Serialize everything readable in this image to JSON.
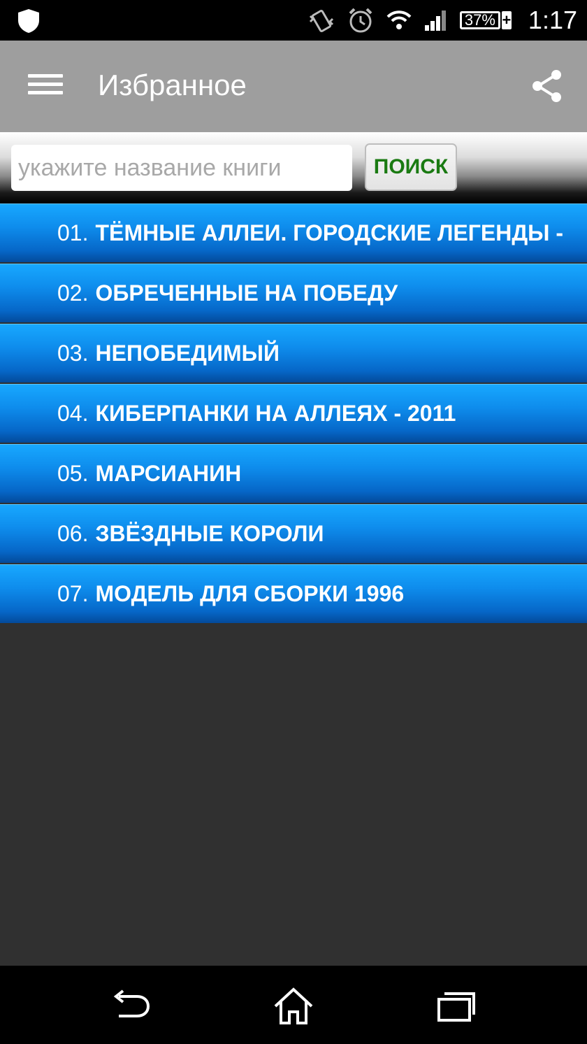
{
  "status_bar": {
    "battery_percent": "37%",
    "time": "1:17",
    "icons": [
      "shield-icon",
      "vibrate-icon",
      "alarm-icon",
      "wifi-icon",
      "signal-icon",
      "battery-icon"
    ]
  },
  "app_bar": {
    "title": "Избранное",
    "menu_icon": "hamburger-menu-icon",
    "share_icon": "share-icon"
  },
  "search": {
    "placeholder": "укажите название книги",
    "value": "",
    "button_label": "ПОИСК"
  },
  "books": [
    {
      "num": "01.",
      "title": "ТЁМНЫЕ АЛЛЕИ. ГОРОДСКИЕ ЛЕГЕНДЫ -"
    },
    {
      "num": "02.",
      "title": "ОБРЕЧЕННЫЕ НА ПОБЕДУ"
    },
    {
      "num": "03.",
      "title": "НЕПОБЕДИМЫЙ"
    },
    {
      "num": "04.",
      "title": "КИБЕРПАНКИ НА АЛЛЕЯХ - 2011"
    },
    {
      "num": "05.",
      "title": "МАРСИАНИН"
    },
    {
      "num": "06.",
      "title": "ЗВЁЗДНЫЕ КОРОЛИ"
    },
    {
      "num": "07.",
      "title": "МОДЕЛЬ ДЛЯ СБОРКИ 1996"
    }
  ],
  "nav_bar": {
    "icons": [
      "back-icon",
      "home-icon",
      "recent-apps-icon"
    ]
  },
  "colors": {
    "accent_blue": "#0e8cec",
    "search_button_text": "#1a7a12",
    "app_bar": "#9e9e9e"
  }
}
